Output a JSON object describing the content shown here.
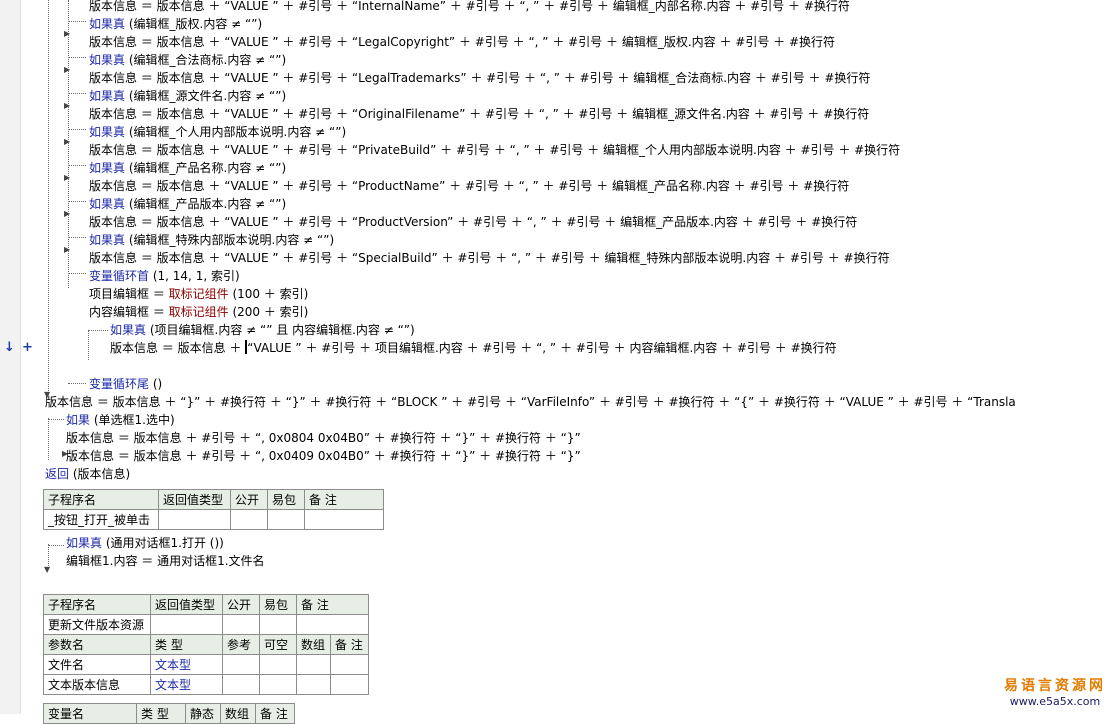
{
  "gutter": {
    "arrow": "↓",
    "plus": "+"
  },
  "code": {
    "l0": "版本信息 ＝ 版本信息 ＋ “VALUE ” ＋ #引号 ＋ “InternalName” ＋ #引号 ＋ “, ” ＋ #引号 ＋ 编辑框_内部名称.内容 ＋ #引号 ＋ #换行符",
    "l1": "(编辑框_版权.内容 ≠ “”)",
    "l2": "版本信息 ＝ 版本信息 ＋ “VALUE ” ＋ #引号 ＋ “LegalCopyright” ＋ #引号 ＋ “, ” ＋ #引号 ＋ 编辑框_版权.内容 ＋ #引号 ＋ #换行符",
    "l3": "(编辑框_合法商标.内容 ≠ “”)",
    "l4": "版本信息 ＝ 版本信息 ＋ “VALUE ” ＋ #引号 ＋ “LegalTrademarks” ＋ #引号 ＋ “, ” ＋ #引号 ＋ 编辑框_合法商标.内容 ＋ #引号 ＋ #换行符",
    "l5": "(编辑框_源文件名.内容 ≠ “”)",
    "l6": "版本信息 ＝ 版本信息 ＋ “VALUE ” ＋ #引号 ＋ “OriginalFilename” ＋ #引号 ＋ “, ” ＋ #引号 ＋ 编辑框_源文件名.内容 ＋ #引号 ＋ #换行符",
    "l7": "(编辑框_个人用内部版本说明.内容 ≠ “”)",
    "l8": "版本信息 ＝ 版本信息 ＋ “VALUE ” ＋ #引号 ＋ “PrivateBuild” ＋ #引号 ＋ “, ” ＋ #引号 ＋ 编辑框_个人用内部版本说明.内容 ＋ #引号 ＋ #换行符",
    "l9": "(编辑框_产品名称.内容 ≠ “”)",
    "l10": "版本信息 ＝ 版本信息 ＋ “VALUE ” ＋ #引号 ＋ “ProductName” ＋ #引号 ＋ “, ” ＋ #引号 ＋ 编辑框_产品名称.内容 ＋ #引号 ＋ #换行符",
    "l11": "(编辑框_产品版本.内容 ≠ “”)",
    "l12": "版本信息 ＝ 版本信息 ＋ “VALUE ” ＋ #引号 ＋ “ProductVersion” ＋ #引号 ＋ “, ” ＋ #引号 ＋ 编辑框_产品版本.内容 ＋ #引号 ＋ #换行符",
    "l13": "(编辑框_特殊内部版本说明.内容 ≠ “”)",
    "l14": "版本信息 ＝ 版本信息 ＋ “VALUE ” ＋ #引号 ＋ “SpecialBuild” ＋ #引号 ＋ “, ” ＋ #引号 ＋ 编辑框_特殊内部版本说明.内容 ＋ #引号 ＋ #换行符",
    "l15": "(1, 14, 1, 索引)",
    "l16a": "项目编辑框 ＝ ",
    "l16fn": "取标记组件",
    "l16b": " (100 ＋ 索引)",
    "l17a": "内容编辑框 ＝ ",
    "l17fn": "取标记组件",
    "l17b": " (200 ＋ 索引)",
    "l18": "(项目编辑框.内容 ≠ “” 且 内容编辑框.内容 ≠ “”)",
    "l19a": "版本信息 ＝ 版本信息 ＋",
    "l19b": "“VALUE ” ＋ #引号 ＋ 项目编辑框.内容 ＋ #引号 ＋ “, ” ＋ #引号 ＋ 内容编辑框.内容 ＋ #引号 ＋ #换行符",
    "l21": " ()",
    "l22": "版本信息 ＝ 版本信息 ＋ “}” ＋ #换行符 ＋ “}” ＋ #换行符 ＋ “BLOCK ” ＋ #引号 ＋ “VarFileInfo” ＋ #引号 ＋ #换行符 ＋ “{” ＋ #换行符 ＋ “VALUE ” ＋ #引号 ＋ “Transla",
    "l23": " (单选框1.选中)",
    "l24": "版本信息 ＝ 版本信息 ＋ #引号 ＋ “, 0x0804 0x04B0” ＋ #换行符 ＋ “}” ＋ #换行符 ＋ “}”",
    "l25": "版本信息 ＝ 版本信息 ＋ #引号 ＋ “, 0x0409 0x04B0” ＋ #换行符 ＋ “}” ＋ #换行符 ＋ “}”",
    "l26": " (版本信息)",
    "l27": " (通用对话框1.打开 ())",
    "l28": "编辑框1.内容 ＝ 通用对话框1.文件名"
  },
  "keywords": {
    "if_true": "如果真",
    "if": "如果",
    "loop_start": "变量循环首",
    "loop_end": "变量循环尾",
    "return": "返回"
  },
  "table1": {
    "headers": [
      "子程序名",
      "返回值类型",
      "公开",
      "易包",
      "备 注"
    ],
    "row": [
      "_按钮_打开_被单击",
      "",
      "",
      "",
      ""
    ]
  },
  "table2": {
    "headers": [
      "子程序名",
      "返回值类型",
      "公开",
      "易包",
      "备 注"
    ],
    "row": [
      "更新文件版本资源",
      "",
      "",
      "",
      ""
    ],
    "param_headers": [
      "参数名",
      "类 型",
      "参考",
      "可空",
      "数组",
      "备 注"
    ],
    "params": [
      [
        "文件名",
        "文本型",
        "",
        "",
        "",
        ""
      ],
      [
        "文本版本信息",
        "文本型",
        "",
        "",
        "",
        ""
      ]
    ]
  },
  "table3": {
    "headers": [
      "变量名",
      "类 型",
      "静态",
      "数组",
      "备 注"
    ]
  },
  "watermark": {
    "line1": "易语言资源网",
    "line2": "www.e5a5x.com"
  },
  "colors": {
    "keyword": "#1c2aa8",
    "string": "#1a5a9a",
    "function": "#8b0000",
    "table_header": "#e6eee6",
    "watermark": "#e07d00"
  }
}
